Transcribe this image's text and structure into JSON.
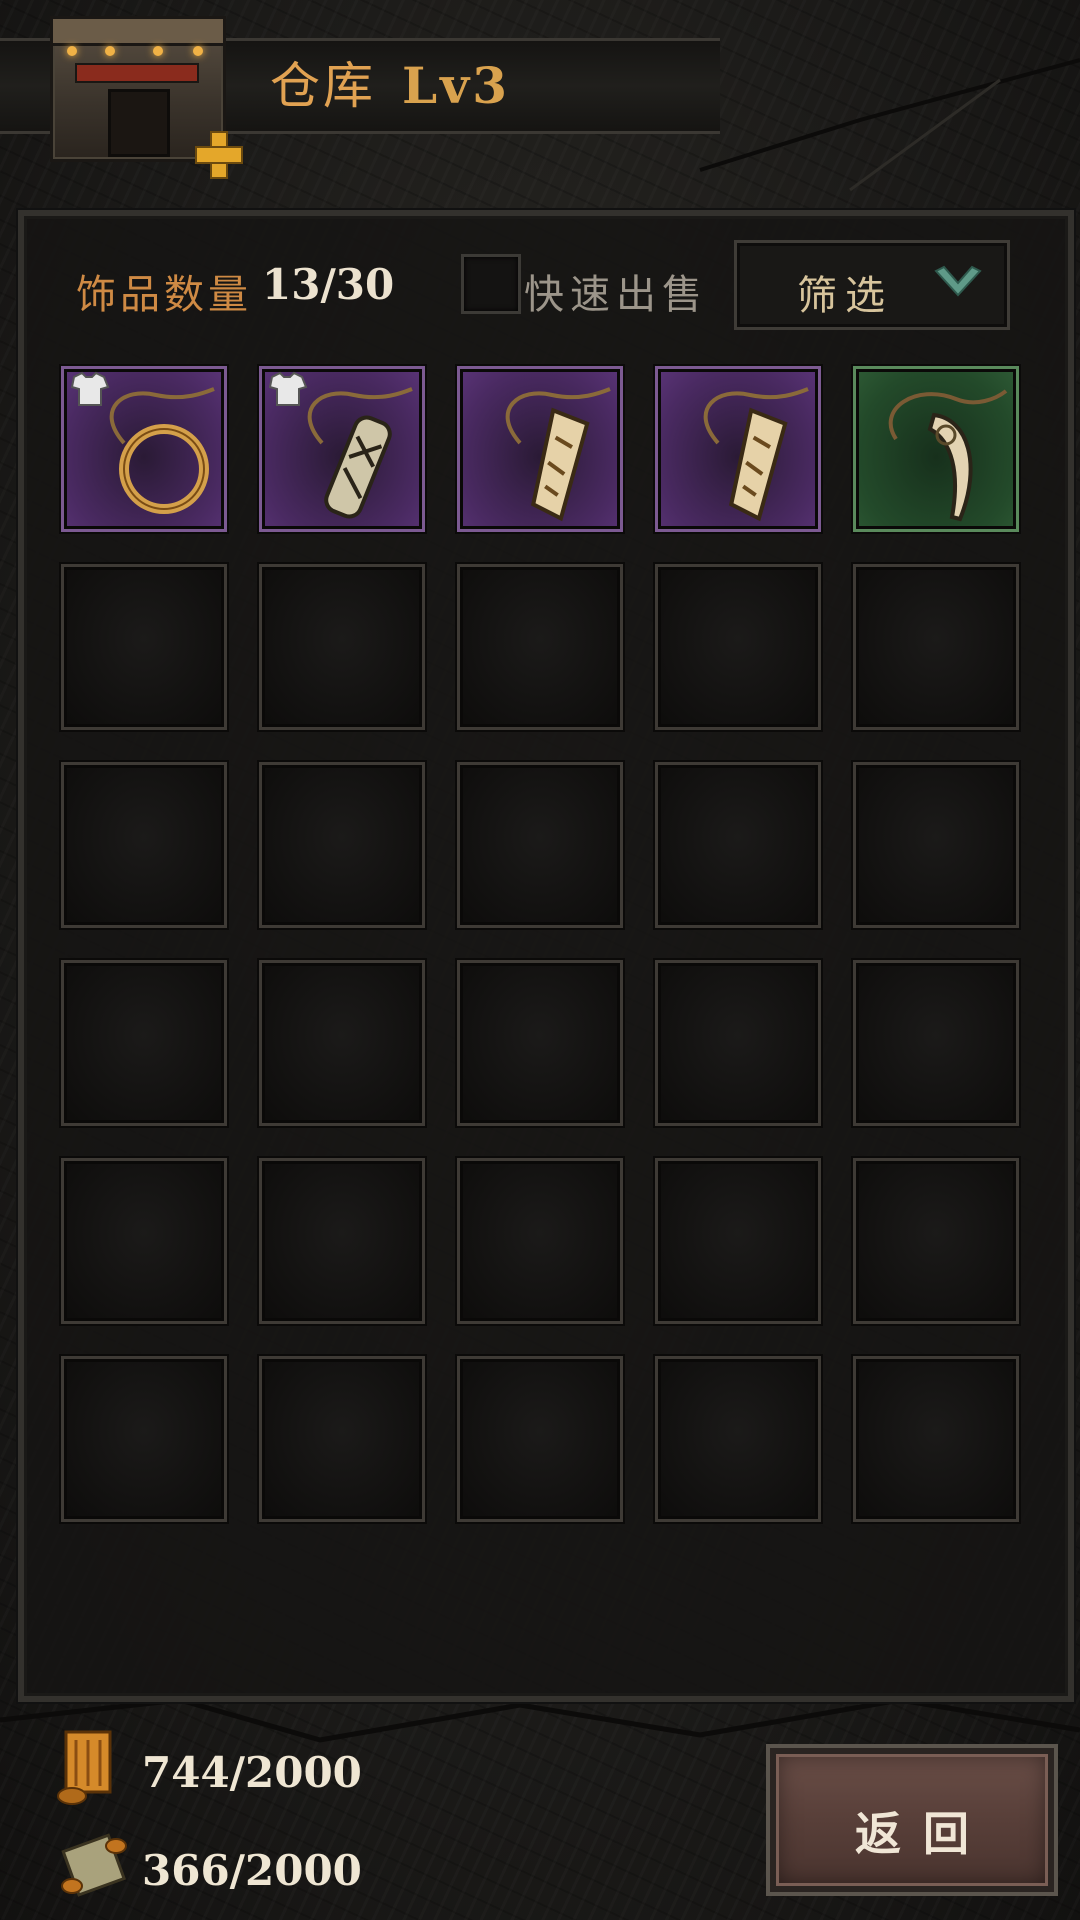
{
  "header": {
    "title": "仓库",
    "level": "Lv3",
    "building_icon": "warehouse-building-icon",
    "upgrade_icon": "plus-icon"
  },
  "toolbar": {
    "count_label": "饰品数量",
    "count_value": "13/30",
    "quick_sell_label": "快速出售",
    "quick_sell_checked": false,
    "filter_label": "筛选",
    "filter_icon": "chevron-down-icon"
  },
  "inventory": {
    "columns": 5,
    "rows": 6,
    "items": [
      {
        "name": "ring-trinket",
        "rarity": "purple",
        "equipped": true
      },
      {
        "name": "carved-charm-trinket",
        "rarity": "purple",
        "equipped": true
      },
      {
        "name": "bone-pendant-trinket",
        "rarity": "purple",
        "equipped": false
      },
      {
        "name": "bone-pendant-trinket",
        "rarity": "purple",
        "equipped": false
      },
      {
        "name": "tooth-necklace-trinket",
        "rarity": "green",
        "equipped": false
      }
    ]
  },
  "resources": [
    {
      "icon": "scroll-icon",
      "value": "744/2000"
    },
    {
      "icon": "map-scroll-icon",
      "value": "366/2000"
    }
  ],
  "back_button": {
    "label": "返回"
  },
  "colors": {
    "title": "#e1a252",
    "purple_rarity": "#5a3477",
    "green_rarity": "#2e5a35",
    "accent_chevron": "#5f9a88"
  }
}
